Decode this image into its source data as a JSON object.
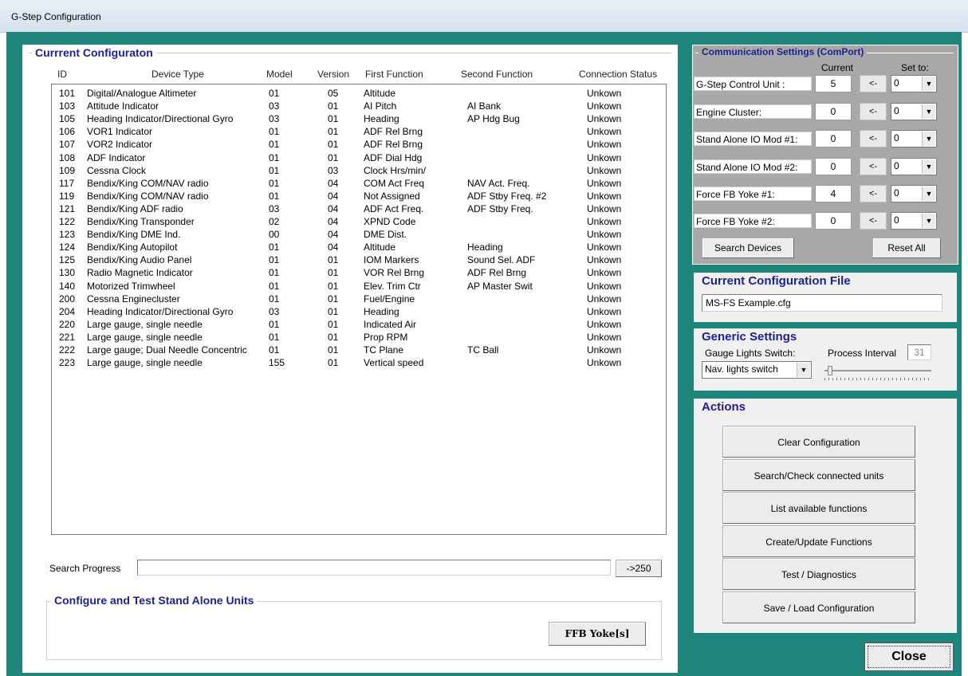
{
  "window": {
    "title": "G-Step Configuration"
  },
  "config_panel": {
    "title": "Currrent Configuraton",
    "columns": [
      "ID",
      "Device Type",
      "Model",
      "Version",
      "First Function",
      "Second Function",
      "Connection Status"
    ],
    "rows": [
      [
        "101",
        "Digital/Analogue Altimeter",
        "01",
        "05",
        "Altitude",
        "",
        "Unkown"
      ],
      [
        "103",
        "Attitude Indicator",
        "03",
        "01",
        "AI Pitch",
        "AI Bank",
        "Unkown"
      ],
      [
        "105",
        "Heading Indicator/Directional Gyro",
        "03",
        "01",
        "Heading",
        "AP Hdg Bug",
        "Unkown"
      ],
      [
        "106",
        "VOR1 Indicator",
        "01",
        "01",
        "ADF Rel Brng",
        "",
        "Unkown"
      ],
      [
        "107",
        "VOR2 Indicator",
        "01",
        "01",
        "ADF Rel Brng",
        "",
        "Unkown"
      ],
      [
        "108",
        "ADF Indicator",
        "01",
        "01",
        "ADF Dial Hdg",
        "",
        "Unkown"
      ],
      [
        "109",
        "Cessna Clock",
        "01",
        "03",
        "Clock Hrs/min/",
        "",
        "Unkown"
      ],
      [
        "117",
        "Bendix/King COM/NAV radio",
        "01",
        "04",
        "COM Act Freq",
        "NAV Act. Freq.",
        "Unkown"
      ],
      [
        "119",
        "Bendix/King COM/NAV radio",
        "01",
        "04",
        "Not Assigned",
        "ADF Stby Freq. #2",
        "Unkown"
      ],
      [
        "121",
        "Bendix/King ADF radio",
        "03",
        "04",
        "ADF Act Freq.",
        "ADF Stby Freq.",
        "Unkown"
      ],
      [
        "122",
        "Bendix/King Transponder",
        "02",
        "04",
        "XPND Code",
        "",
        "Unkown"
      ],
      [
        "123",
        "Bendix/King DME Ind.",
        "00",
        "04",
        "DME Dist.",
        "",
        "Unkown"
      ],
      [
        "124",
        "Bendix/King Autopilot",
        "01",
        "04",
        "Altitude",
        "Heading",
        "Unkown"
      ],
      [
        "125",
        "Bendix/King Audio Panel",
        "01",
        "01",
        "IOM Markers",
        "Sound Sel. ADF",
        "Unkown"
      ],
      [
        "130",
        "Radio Magnetic Indicator",
        "01",
        "01",
        "VOR Rel Brng",
        "ADF Rel Brng",
        "Unkown"
      ],
      [
        "140",
        "Motorized Trimwheel",
        "01",
        "01",
        "Elev. Trim Ctr",
        "AP Master Swit",
        "Unkown"
      ],
      [
        "200",
        "Cessna Enginecluster",
        "01",
        "01",
        "Fuel/Engine",
        "",
        "Unkown"
      ],
      [
        "204",
        "Heading Indicator/Directional Gyro",
        "03",
        "01",
        "Heading",
        "",
        "Unkown"
      ],
      [
        "220",
        "Large gauge, single needle",
        "01",
        "01",
        "Indicated Air",
        "",
        "Unkown"
      ],
      [
        "221",
        "Large gauge, single needle",
        "01",
        "01",
        "Prop RPM",
        "",
        "Unkown"
      ],
      [
        "222",
        "Large gauge; Dual Needle Concentric",
        "01",
        "01",
        "TC Plane",
        "TC Ball",
        "Unkown"
      ],
      [
        "223",
        "Large gauge, single needle",
        "155",
        "01",
        "Vertical speed",
        "",
        "Unkown"
      ]
    ],
    "search_progress_label": "Search Progress",
    "search_progress_value": 0,
    "search_range_button": "->250",
    "standalone_title": "Configure and Test Stand Alone Units",
    "ffb_button": "FFB  Yoke[s]"
  },
  "comm_settings": {
    "title": "Communication Settings (ComPort)",
    "current_header": "Current",
    "setto_header": "Set to:",
    "arrow_label": "<-",
    "rows": [
      {
        "label": "G-Step Control Unit :",
        "current": "5",
        "set_to": "0"
      },
      {
        "label": "Engine Cluster:",
        "current": "0",
        "set_to": "0"
      },
      {
        "label": "Stand Alone IO Mod #1:",
        "current": "0",
        "set_to": "0"
      },
      {
        "label": "Stand Alone IO Mod #2:",
        "current": "0",
        "set_to": "0"
      },
      {
        "label": "Force FB Yoke #1:",
        "current": "4",
        "set_to": "0"
      },
      {
        "label": "Force FB Yoke #2:",
        "current": "0",
        "set_to": "0"
      }
    ],
    "search_button": "Search Devices",
    "reset_button": "Reset All"
  },
  "config_file": {
    "title": "Current Configuration File",
    "value": "MS-FS Example.cfg"
  },
  "generic_settings": {
    "title": "Generic Settings",
    "gauge_lights_label": "Gauge Lights Switch:",
    "gauge_lights_value": "Nav. lights switch",
    "process_interval_label": "Process Interval",
    "process_interval_value": "31"
  },
  "actions": {
    "title": "Actions",
    "buttons": [
      "Clear Configuration",
      "Search/Check connected units",
      "List available functions",
      "Create/Update Functions",
      "Test / Diagnostics",
      "Save / Load Configuration"
    ]
  },
  "close_button": "Close"
}
